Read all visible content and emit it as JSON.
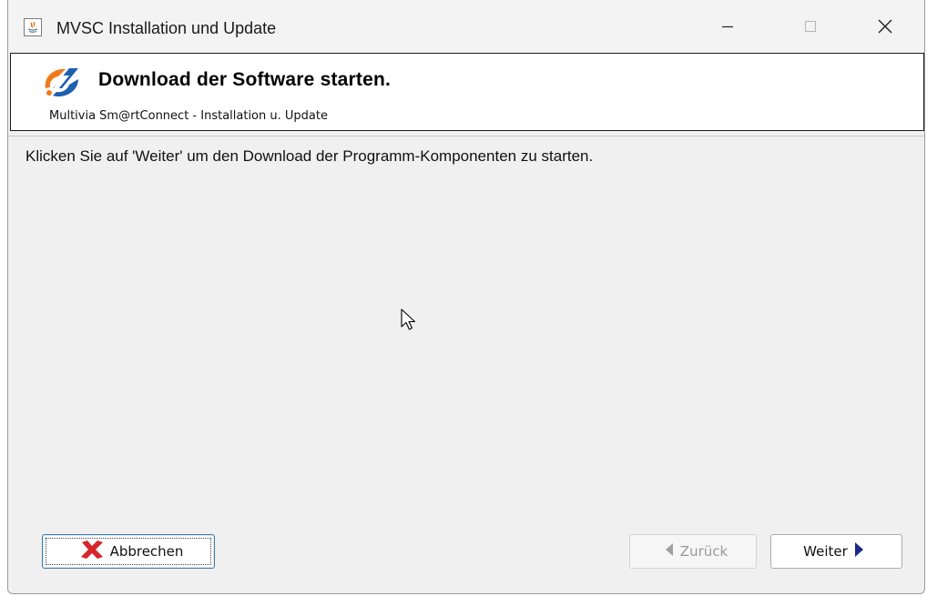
{
  "window": {
    "title": "MVSC Installation und Update"
  },
  "header": {
    "title": "Download der Software starten.",
    "subtitle": "Multivia Sm@rtConnect - Installation u. Update"
  },
  "content": {
    "instruction": "Klicken Sie auf 'Weiter' um den Download der Programm-Komponenten zu starten."
  },
  "buttons": {
    "cancel_label": "Abbrechen",
    "back_label": "Zurück",
    "next_label": "Weiter"
  },
  "icons": {
    "app": "java-app-icon",
    "logo": "multivia-logo-icon",
    "cancel": "red-x-icon",
    "back": "left-arrow-icon",
    "next": "right-arrow-icon"
  },
  "colors": {
    "cancel_icon": "#d7262b",
    "next_arrow": "#1a2a8a",
    "back_arrow_disabled": "#a0a0a0",
    "logo_orange": "#f07a1a",
    "logo_blue": "#1e5fb0",
    "focus_border": "#3c7fb1"
  },
  "state": {
    "back_enabled": false,
    "focused_button": "cancel"
  }
}
